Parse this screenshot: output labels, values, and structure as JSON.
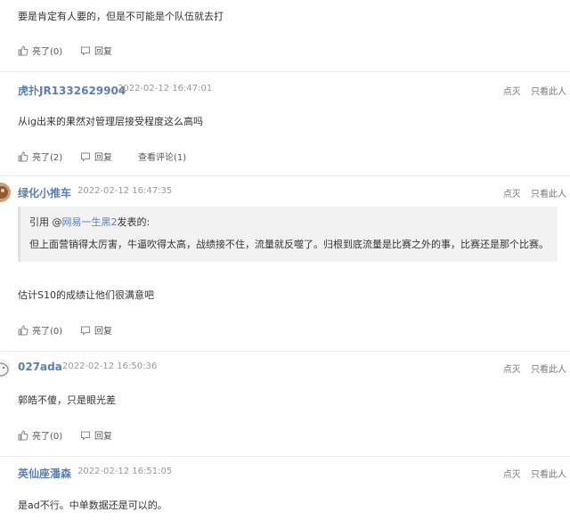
{
  "comments": [
    {
      "author": "",
      "time": "",
      "text": "要是肯定有人要的，但是不可能是个队伍就去打",
      "like": "亮了(0)",
      "reply": "回复"
    },
    {
      "author": "虎扑JR1332629904",
      "time": "2022-02-12 16:47:01",
      "text": "从ig出来的果然对管理层接受程度这么高吗",
      "like": "亮了(2)",
      "reply": "回复",
      "view": "查看评论(1)"
    },
    {
      "author": "绿化小推车",
      "time": "2022-02-12 16:47:35",
      "quote_prefix": "引用 @",
      "quote_user": "网易一生黑2",
      "quote_suffix": "发表的:",
      "quote_text": "但上面营销得太厉害，牛逼吹得太高，战绩接不住，流量就反噬了。归根到底流量是比赛之外的事，比赛还是那个比赛。",
      "text": "估计S10的成绩让他们很满意吧",
      "like": "亮了(0)",
      "reply": "回复"
    },
    {
      "author": "027ada",
      "time": "2022-02-12 16:50:36",
      "text": "郭皓不傻，只是眼光差",
      "like": "亮了(0)",
      "reply": "回复"
    },
    {
      "author": "英仙座潘森",
      "time": "2022-02-12 16:51:05",
      "text": "是ad不行。中单数据还是可以的。"
    }
  ],
  "labels": {
    "dislike": "点灭",
    "only_this": "只看此人"
  },
  "colors": {
    "link": "#5b7fb3",
    "muted": "#999999",
    "divider": "#ececec"
  }
}
